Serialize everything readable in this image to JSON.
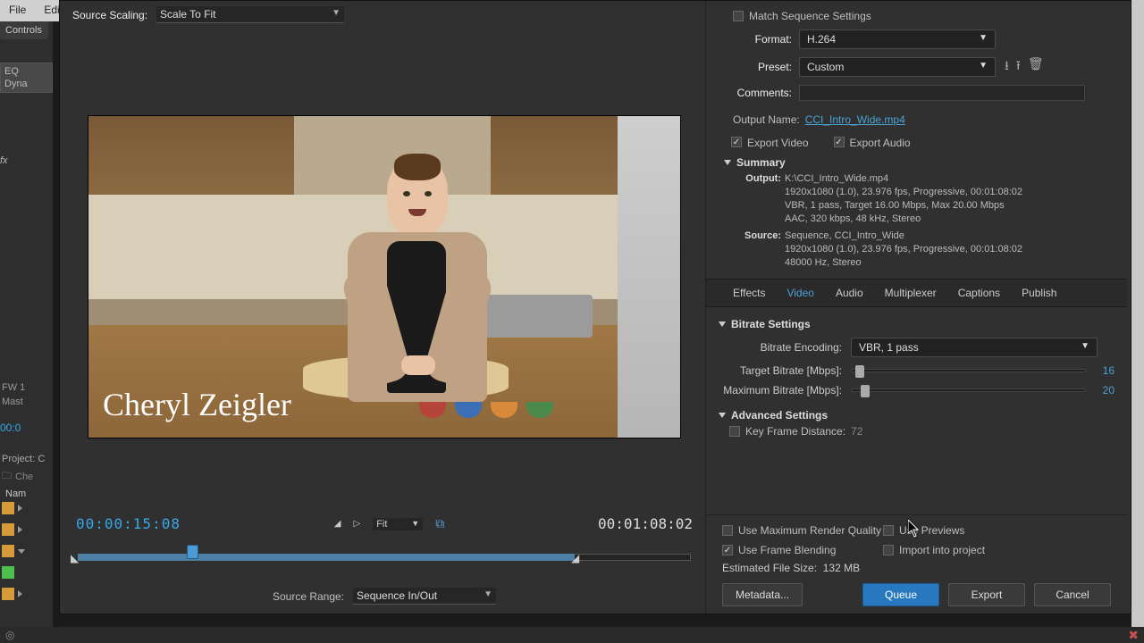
{
  "menu": {
    "file": "File",
    "edit": "Edit"
  },
  "leftPanel": {
    "controls_tab": "Controls",
    "eq": "EQ",
    "dyn": "Dyna",
    "fw": "FW 1",
    "mast": "Mast",
    "tc": "00:0",
    "project_label": "Project: C",
    "search_ph": "Che",
    "name_col": "Nam"
  },
  "sourceScaling": {
    "label": "Source Scaling:",
    "value": "Scale To Fit"
  },
  "lowerThird": "Cheryl Zeigler",
  "timecode": {
    "current": "00:00:15:08",
    "duration": "00:01:08:02",
    "fit": "Fit"
  },
  "sourceRange": {
    "label": "Source Range:",
    "value": "Sequence In/Out"
  },
  "export": {
    "match_seq": "Match Sequence Settings",
    "format_label": "Format:",
    "format_value": "H.264",
    "preset_label": "Preset:",
    "preset_value": "Custom",
    "comments_label": "Comments:",
    "outputname_label": "Output Name:",
    "outputname_value": "CCI_Intro_Wide.mp4",
    "export_video": "Export Video",
    "export_audio": "Export Audio",
    "summary_label": "Summary",
    "summary": {
      "output_k": "Output:",
      "output_v": "K:\\CCI_Intro_Wide.mp4\n1920x1080 (1.0), 23.976 fps, Progressive, 00:01:08:02\nVBR, 1 pass, Target 16.00 Mbps, Max 20.00 Mbps\nAAC, 320 kbps, 48 kHz, Stereo",
      "source_k": "Source:",
      "source_v": "Sequence, CCI_Intro_Wide\n1920x1080 (1.0), 23.976 fps, Progressive, 00:01:08:02\n48000 Hz, Stereo"
    }
  },
  "tabs": {
    "effects": "Effects",
    "video": "Video",
    "audio": "Audio",
    "multiplexer": "Multiplexer",
    "captions": "Captions",
    "publish": "Publish"
  },
  "bitrate": {
    "section": "Bitrate Settings",
    "encoding_label": "Bitrate Encoding:",
    "encoding_value": "VBR, 1 pass",
    "target_label": "Target Bitrate [Mbps]:",
    "target_value": "16",
    "max_label": "Maximum Bitrate [Mbps]:",
    "max_value": "20"
  },
  "advanced": {
    "section": "Advanced Settings",
    "kf_label": "Key Frame Distance:",
    "kf_value": "72"
  },
  "bottom": {
    "max_render": "Use Maximum Render Quality",
    "previews": "Use Previews",
    "frame_blend": "Use Frame Blending",
    "import": "Import into project",
    "est_label": "Estimated File Size:",
    "est_value": "132 MB",
    "metadata": "Metadata...",
    "queue": "Queue",
    "export_btn": "Export",
    "cancel": "Cancel"
  },
  "colors": {
    "orange": "#d79a3a",
    "green": "#4fbf4f"
  }
}
